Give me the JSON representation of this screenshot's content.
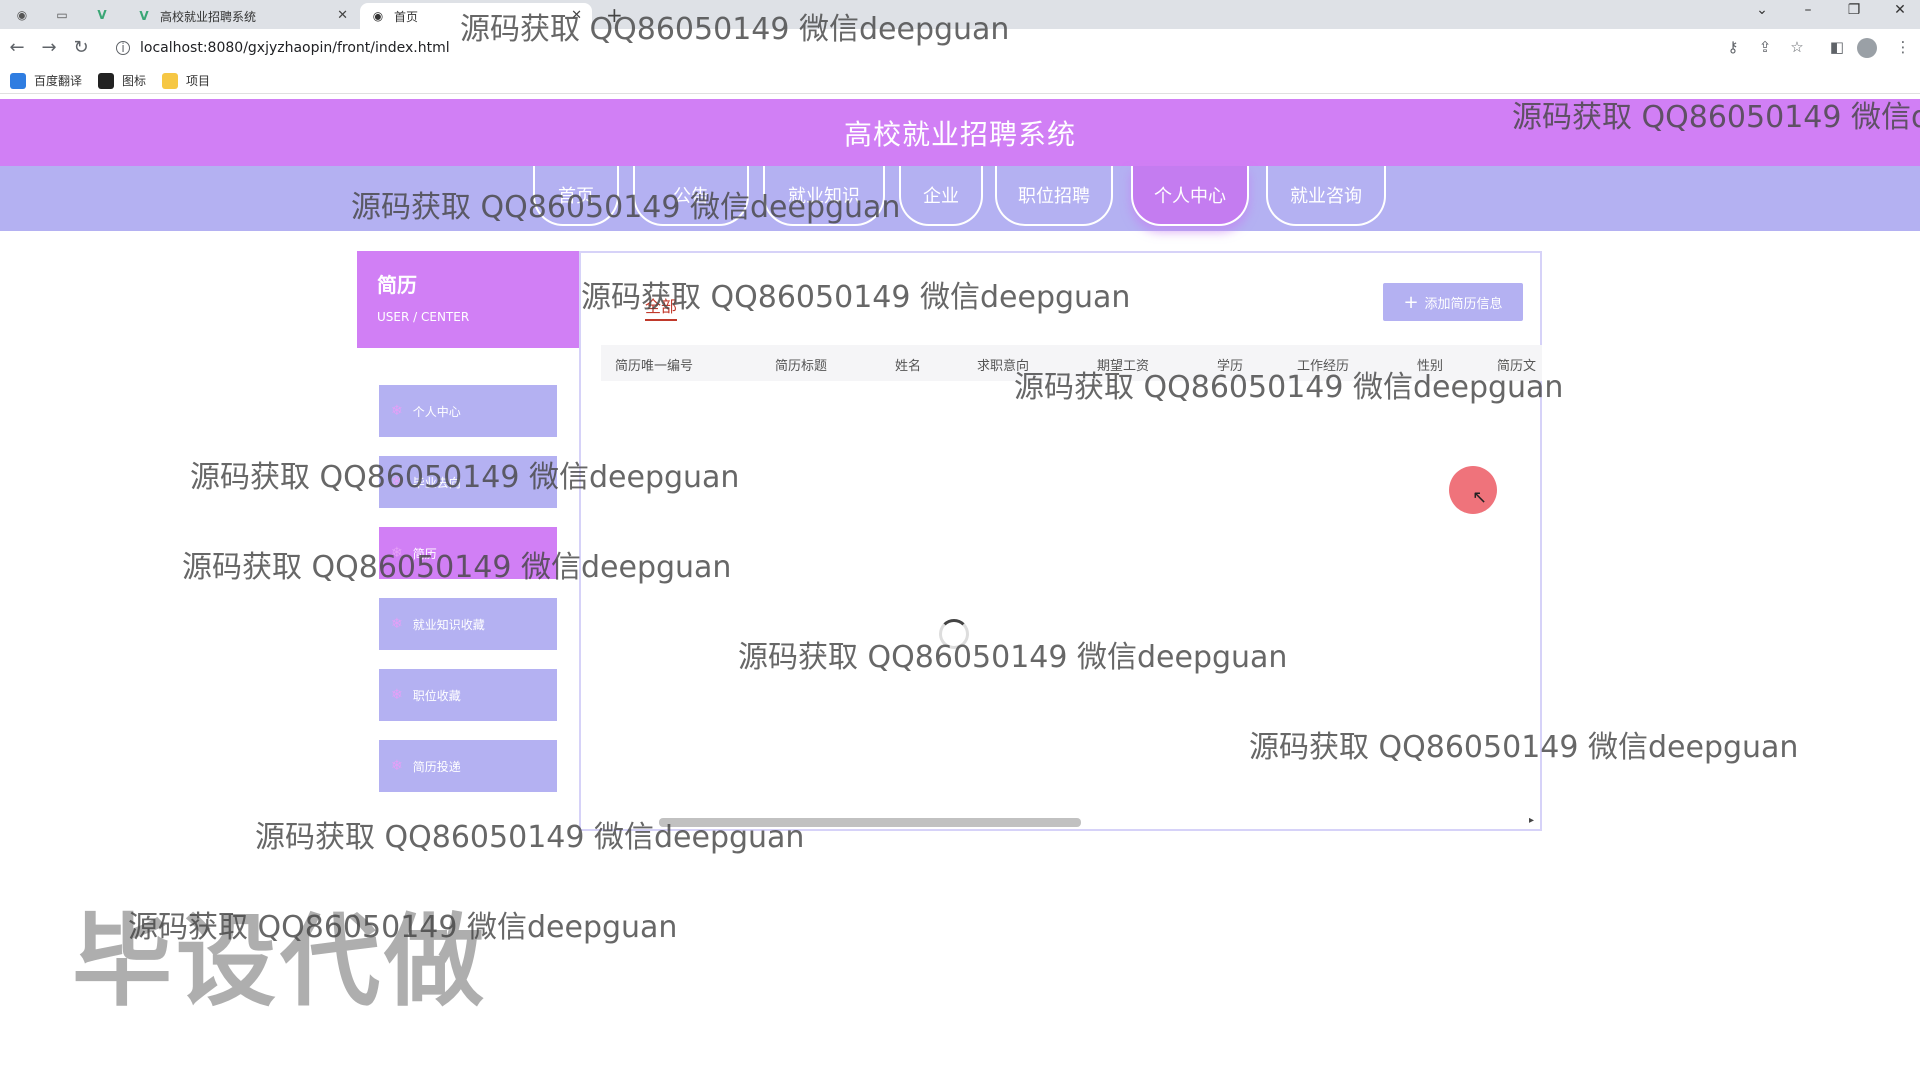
{
  "browser": {
    "tabs": [
      {
        "label": "高校就业招聘系统",
        "active": false
      },
      {
        "label": "首页",
        "active": true
      }
    ],
    "url": "localhost:8080/gxjyzhaopin/front/index.html",
    "bookmarks": [
      "百度翻译",
      "图标",
      "项目"
    ]
  },
  "header": {
    "title": "高校就业招聘系统"
  },
  "nav": {
    "items": [
      {
        "label": "首页"
      },
      {
        "label": "公告"
      },
      {
        "label": "就业知识"
      },
      {
        "label": "企业"
      },
      {
        "label": "职位招聘"
      },
      {
        "label": "个人中心"
      },
      {
        "label": "就业咨询"
      }
    ],
    "active": "个人中心"
  },
  "sidebar": {
    "title": "简历",
    "subtitle": "USER / CENTER",
    "items": [
      {
        "label": "个人中心"
      },
      {
        "label": "毕业去向"
      },
      {
        "label": "简历"
      },
      {
        "label": "就业知识收藏"
      },
      {
        "label": "职位收藏"
      },
      {
        "label": "简历投递"
      }
    ],
    "active": "简历"
  },
  "main": {
    "filter_all": "全部",
    "add_button": "添加简历信息",
    "table_headers": [
      "简历唯一编号",
      "简历标题",
      "姓名",
      "求职意向",
      "期望工资",
      "学历",
      "工作经历",
      "性别",
      "简历文"
    ]
  },
  "overlay": {
    "watermark_text": "源码获取 QQ86050149 微信deepguan",
    "watermark_partial": "源码获取 QQ86050149 微信d",
    "big_mark": "毕设代做"
  },
  "colors": {
    "header": "#d17ff5",
    "navbar": "#b4b1f2",
    "accent_red": "#c0392b"
  }
}
